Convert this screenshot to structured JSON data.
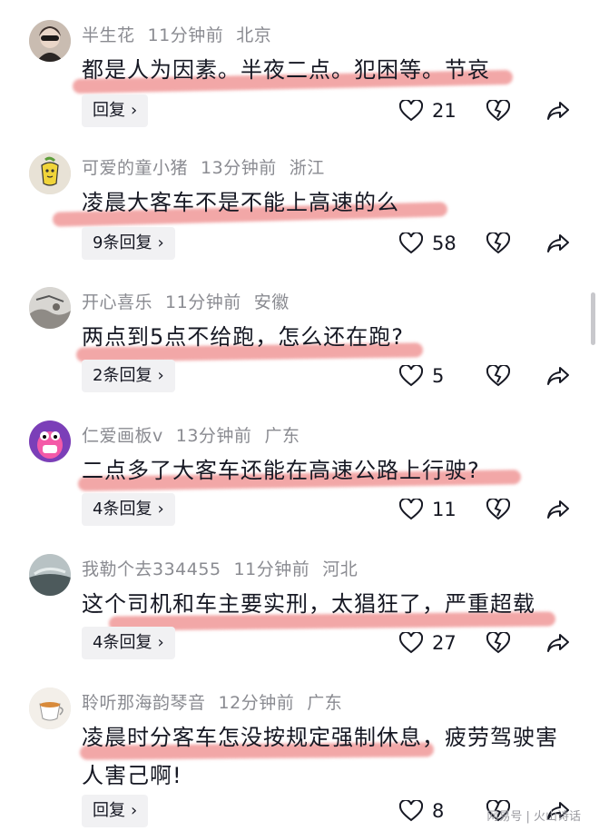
{
  "comments": [
    {
      "user": "半生花",
      "time": "11分钟前",
      "location": "北京",
      "text": "都是人为因素。半夜二点。犯困等。节哀",
      "reply_label": "回复",
      "likes": "21"
    },
    {
      "user": "可爱的童小猪",
      "time": "13分钟前",
      "location": "浙江",
      "text": "凌晨大客车不是不能上高速的么",
      "reply_label": "9条回复",
      "likes": "58"
    },
    {
      "user": "开心喜乐",
      "time": "11分钟前",
      "location": "安徽",
      "text": "两点到5点不给跑，怎么还在跑?",
      "reply_label": "2条回复",
      "likes": "5"
    },
    {
      "user": "仁爱画板v",
      "time": "13分钟前",
      "location": "广东",
      "text": "二点多了大客车还能在高速公路上行驶?",
      "reply_label": "4条回复",
      "likes": "11"
    },
    {
      "user": "我勒个去334455",
      "time": "11分钟前",
      "location": "河北",
      "text": "这个司机和车主要实刑，太猖狂了，严重超载",
      "reply_label": "4条回复",
      "likes": "27"
    },
    {
      "user": "聆听那海韵琴音",
      "time": "12分钟前",
      "location": "广东",
      "text": "凌晨时分客车怎没按规定强制休息，疲劳驾驶害人害己啊!",
      "reply_label": "回复",
      "likes": "8"
    }
  ],
  "watermark": "网易号 | 火山诗话",
  "colors": {
    "highlight": "#e85f5f",
    "muted": "#8a8b91",
    "button_bg": "#f1f1f3"
  },
  "icons": {
    "like": "heart-icon",
    "dislike": "broken-heart-icon",
    "share": "share-arrow-icon",
    "reply_chevron": "chevron-right-icon"
  }
}
